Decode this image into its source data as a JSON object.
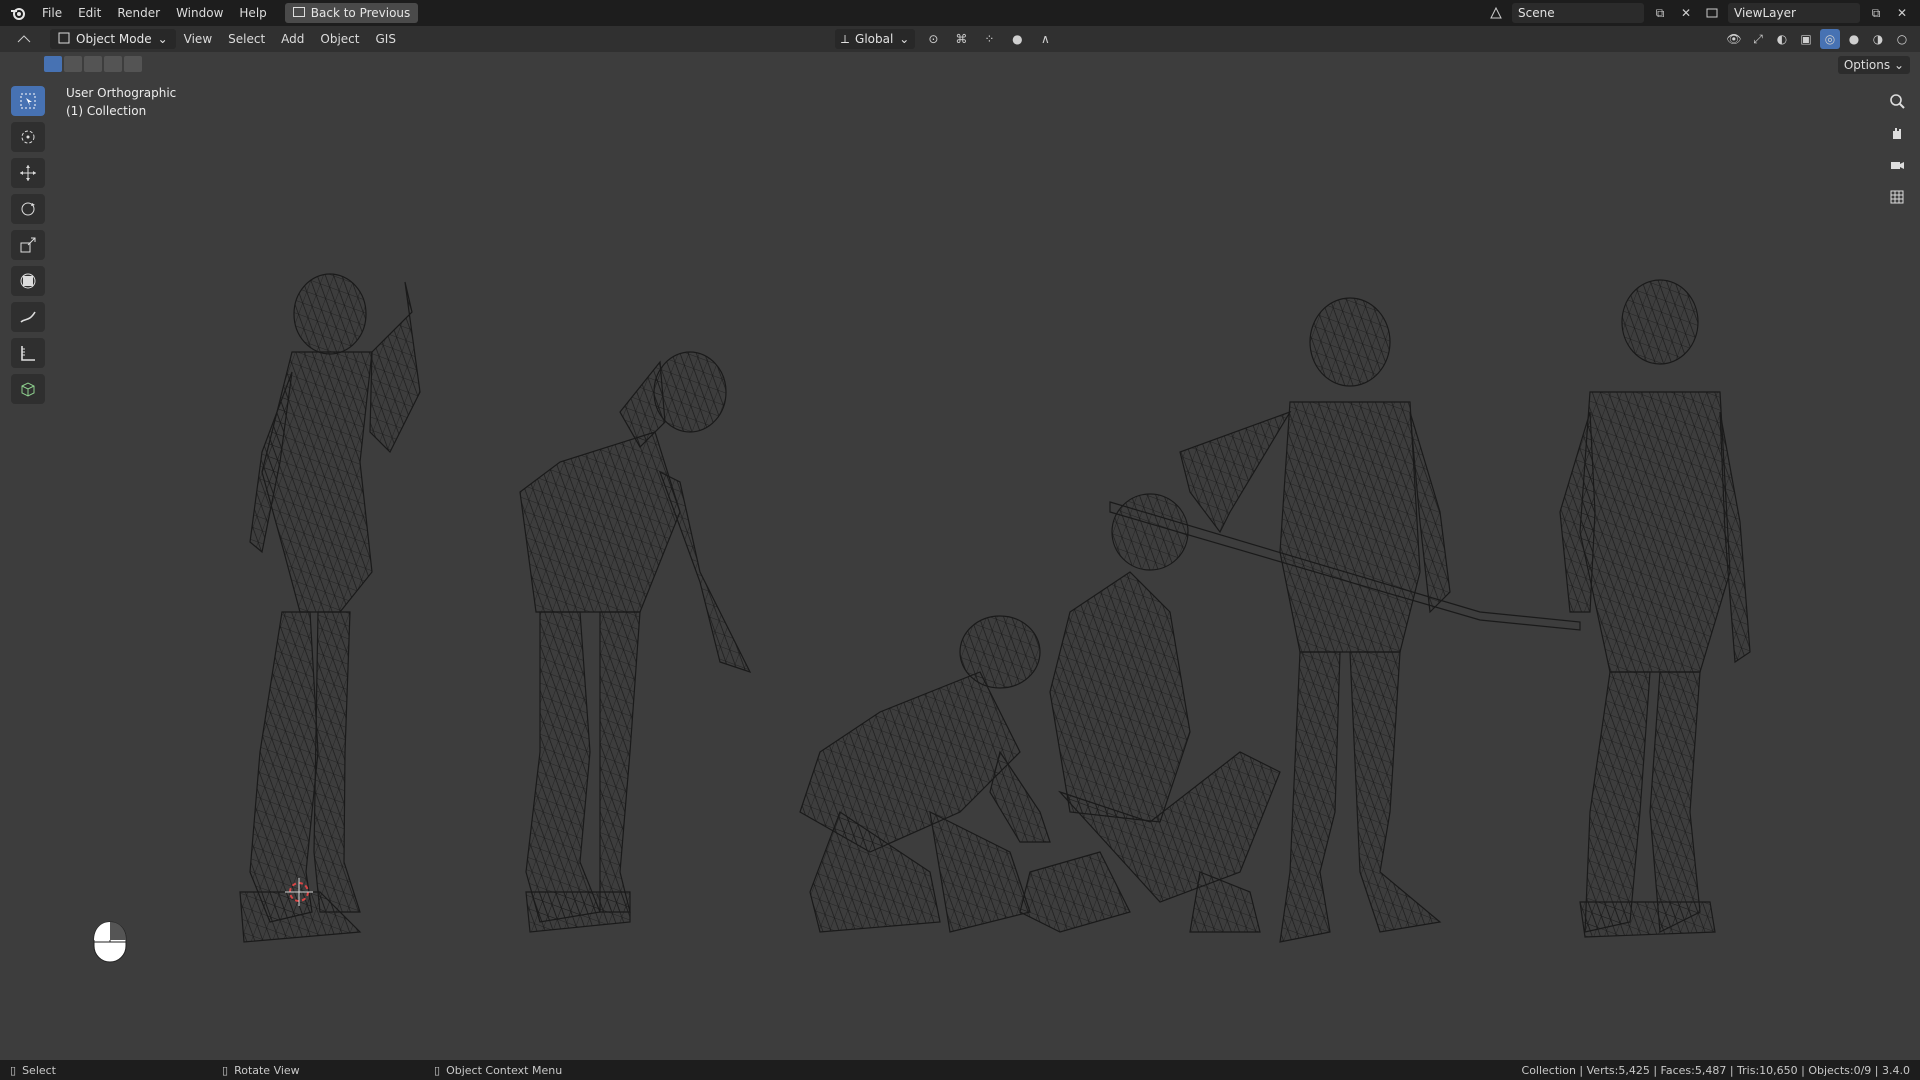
{
  "topbar": {
    "menus": [
      "File",
      "Edit",
      "Render",
      "Window",
      "Help"
    ],
    "back_button": "Back to Previous",
    "scene_name": "Scene",
    "view_layer": "ViewLayer"
  },
  "header": {
    "mode": "Object Mode",
    "menus": [
      "View",
      "Select",
      "Add",
      "Object",
      "GIS"
    ],
    "orientation": "Global",
    "options": "Options"
  },
  "viewport": {
    "view_name": "User Orthographic",
    "collection": "(1) Collection"
  },
  "statusbar": {
    "hint_select": "Select",
    "hint_rotate": "Rotate View",
    "hint_context": "Object Context Menu",
    "stats": "Collection | Verts:5,425 | Faces:5,487 | Tris:10,650 | Objects:0/9 | 3.4.0"
  },
  "icons": {
    "logo": "blender-logo-icon",
    "tools": [
      "select-box-icon",
      "cursor-icon",
      "move-icon",
      "rotate-icon",
      "scale-icon",
      "transform-icon",
      "annotate-icon",
      "measure-icon",
      "add-cube-icon"
    ],
    "nav": [
      "zoom-icon",
      "pan-hand-icon",
      "camera-icon",
      "grid-icon"
    ]
  },
  "colors": {
    "accent": "#4772b3",
    "viewport_bg": "#3d3d3d",
    "wire": "#1a1a1a"
  }
}
